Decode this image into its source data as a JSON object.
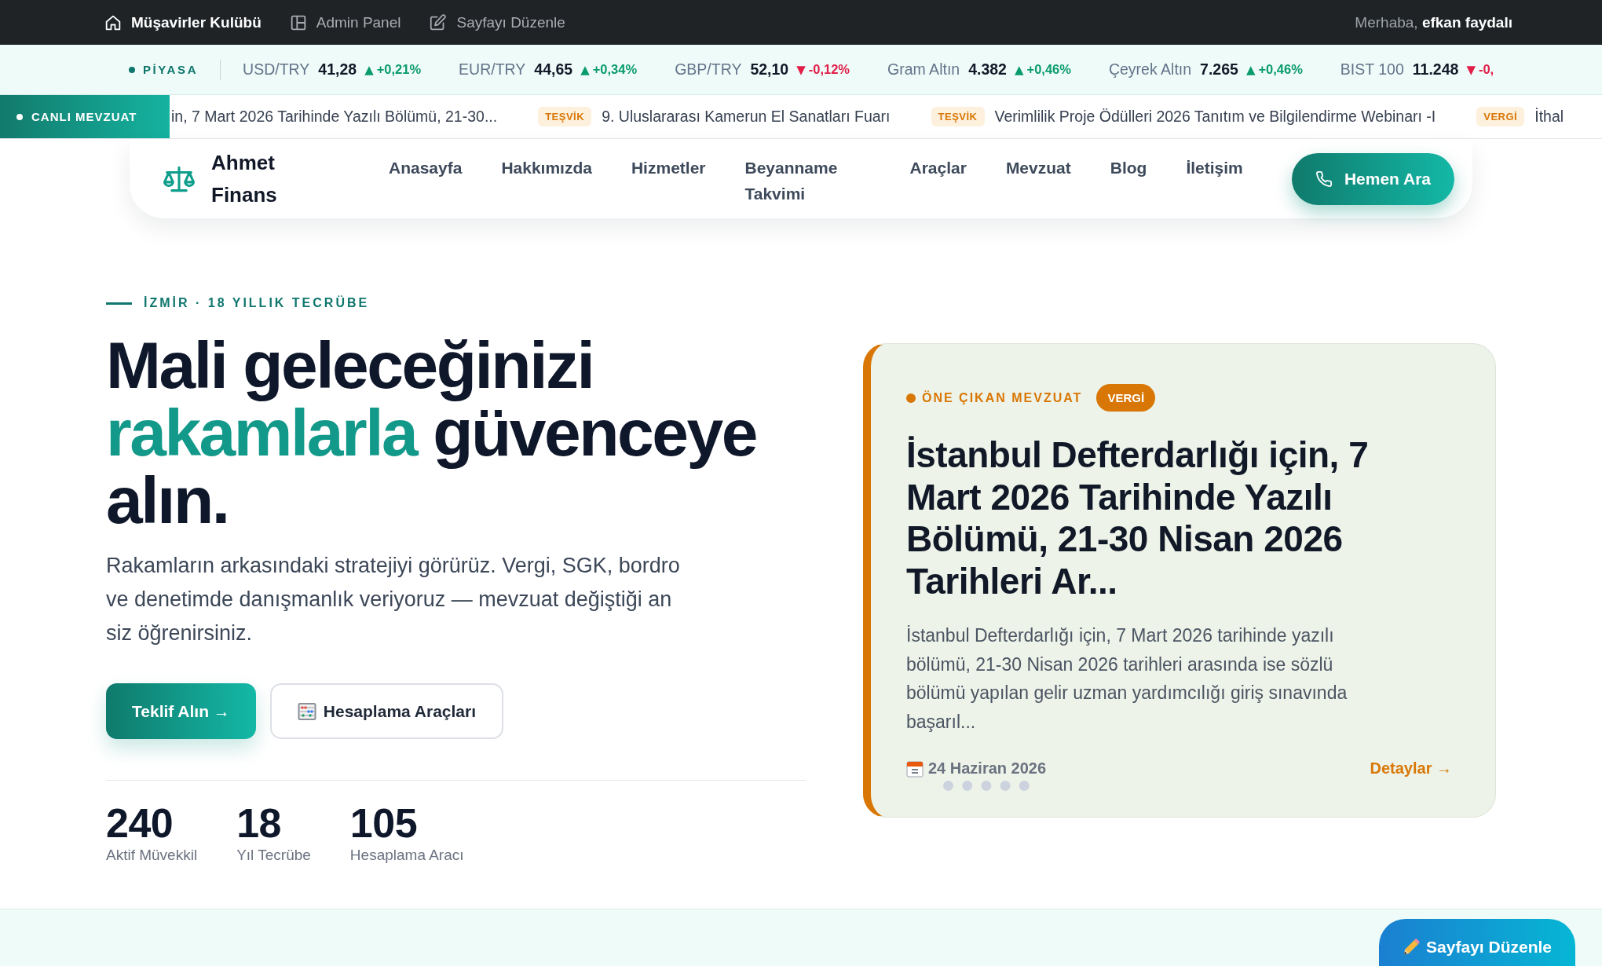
{
  "top_bar": {
    "links": [
      {
        "label": "Müşavirler Kulübü",
        "selected": true
      },
      {
        "label": "Admin Panel",
        "selected": false
      },
      {
        "label": "Sayfayı Düzenle",
        "selected": false
      }
    ],
    "greeting": "Merhaba, **efkan faydalı**"
  },
  "market_ticker": {
    "label": "PİYASA",
    "items": [
      {
        "name": "USD/TRY",
        "value": "41,28",
        "arrow": "▲",
        "change": "+0,21%",
        "color": "#0a9b6c"
      },
      {
        "name": "EUR/TRY",
        "value": "44,65",
        "arrow": "▲",
        "change": "+0,34%",
        "color": "#0a9b6c"
      },
      {
        "name": "GBP/TRY",
        "value": "52,10",
        "arrow": "▼",
        "change": "-0,12%",
        "color": "#e11d48"
      },
      {
        "name": "Gram Altın",
        "value": "4.382",
        "arrow": "▲",
        "change": "+0,46%",
        "color": "#0a9b6c"
      },
      {
        "name": "Çeyrek Altın",
        "value": "7.265",
        "arrow": "▲",
        "change": "+0,46%",
        "color": "#0a9b6c"
      },
      {
        "name": "BIST 100",
        "value": "11.248",
        "arrow": "▼",
        "change": "-0,",
        "color": "#e11d48"
      }
    ]
  },
  "news_ticker": {
    "label": "CANLI MEVZUAT",
    "items": [
      {
        "text": "in, 7 Mart 2026 Tarihinde Yazılı Bölümü, 21-30..."
      },
      {
        "tag": "TEŞVİK",
        "text": "9. Uluslararası Kamerun El Sanatları Fuarı"
      },
      {
        "tag": "TEŞVİK",
        "text": "Verimlilik Proje Ödülleri 2026 Tanıtım ve Bilgilendirme Webinarı -I"
      },
      {
        "tag": "VERGİ",
        "text": "İthal"
      }
    ]
  },
  "header": {
    "brand": "Ahmet Finans",
    "nav": [
      "Anasayfa",
      "Hakkımızda",
      "Hizmetler",
      "Beyanname Takvimi",
      "Araçlar",
      "Mevzuat",
      "Blog",
      "İletişim"
    ],
    "call_button": "Hemen Ara"
  },
  "hero": {
    "eyebrow": "İZMİR · 18 YILLIK TECRÜBE",
    "heading": [
      {
        "text": "Mali geleceğinizi ",
        "accent": false
      },
      {
        "text": "rakamlarla",
        "accent": true
      },
      {
        "text": " güvenceye alın.",
        "accent": false
      }
    ],
    "lead": "Rakamların arkasındaki stratejiyi görürüz. Vergi, SGK, bordro ve denetimde danışmanlık veriyoruz — mevzuat değiştiği an siz öğrenirsiniz.",
    "buttons": [
      {
        "label": "Teklif Alın →",
        "kind": "primary"
      },
      {
        "label": "Hesaplama Araçları",
        "kind": "secondary"
      }
    ],
    "stats": [
      {
        "value": "240",
        "label": "Aktif Müvekkil"
      },
      {
        "value": "18",
        "label": "Yıl Tecrübe"
      },
      {
        "value": "105",
        "label": "Hesaplama Aracı"
      }
    ]
  },
  "featured": {
    "label": "ÖNE ÇIKAN MEVZUAT",
    "tag": "VERGİ",
    "title": "İstanbul Defterdarlığı için, 7 Mart 2026 Tarihinde Yazılı Bölümü, 21-30 Nisan 2026 Tarihleri Ar...",
    "summary": "İstanbul Defterdarlığı için, 7 Mart 2026 tarihinde yazılı bölümü, 21-30 Nisan 2026 tarihleri arasında ise sözlü bölümü yapılan gelir uzman yardımcılığı giriş sınavında başarıl...",
    "date": "24 Haziran 2026",
    "link": "Detaylar →"
  },
  "floating_button": "Sayfayı Düzenle"
}
